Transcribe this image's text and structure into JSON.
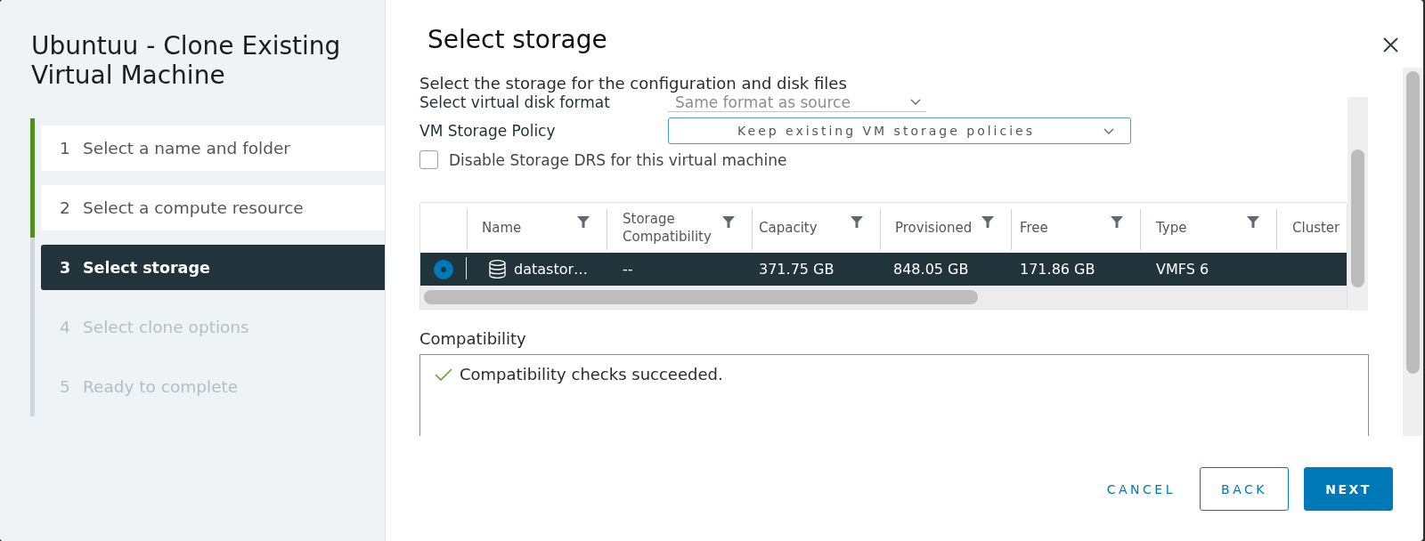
{
  "wizard": {
    "title": "Ubuntuu - Clone Existing Virtual Machine",
    "steps": [
      {
        "number": "1",
        "label": "Select a name and folder",
        "completed": true,
        "selected": false,
        "disabled": false
      },
      {
        "number": "2",
        "label": "Select a compute resource",
        "completed": true,
        "selected": false,
        "disabled": false
      },
      {
        "number": "3",
        "label": "Select storage",
        "completed": false,
        "selected": true,
        "disabled": false
      },
      {
        "number": "4",
        "label": "Select clone options",
        "completed": false,
        "selected": false,
        "disabled": true
      },
      {
        "number": "5",
        "label": "Ready to complete",
        "completed": false,
        "selected": false,
        "disabled": true
      }
    ]
  },
  "page": {
    "title": "Select storage",
    "subtitle": "Select the storage for the configuration and disk files"
  },
  "form": {
    "fields": [
      {
        "label": "Select virtual disk format",
        "value": "Same format as source",
        "kind": "underline"
      },
      {
        "label": "VM Storage Policy",
        "value": "Keep existing VM storage policies",
        "kind": "outlined"
      }
    ],
    "checkbox": {
      "label": "Disable Storage DRS for this virtual machine",
      "checked": false
    }
  },
  "storage_table": {
    "columns": [
      {
        "label": "Name",
        "filter": true
      },
      {
        "label": "Storage Compatibility",
        "filter": true
      },
      {
        "label": "Capacity",
        "filter": true
      },
      {
        "label": "Provisioned",
        "filter": true
      },
      {
        "label": "Free",
        "filter": true
      },
      {
        "label": "Type",
        "filter": true
      },
      {
        "label": "Cluster",
        "filter": false
      }
    ],
    "rows": [
      {
        "selected": true,
        "cells": [
          "datastor…",
          "--",
          "371.75 GB",
          "848.05 GB",
          "171.86 GB",
          "VMFS 6"
        ]
      }
    ]
  },
  "compatibility": {
    "label": "Compatibility",
    "messages": [
      {
        "kind": "success",
        "text": "Compatibility checks succeeded."
      }
    ]
  },
  "buttons": [
    {
      "label": "CANCEL",
      "kind": "flat"
    },
    {
      "label": "BACK",
      "kind": "outline"
    },
    {
      "label": "NEXT",
      "kind": "primary"
    }
  ]
}
